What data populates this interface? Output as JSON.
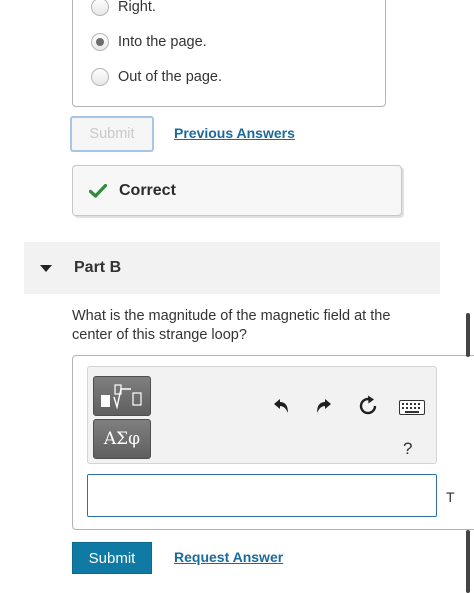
{
  "part_a": {
    "choices": [
      {
        "label": "Right.",
        "selected": false
      },
      {
        "label": "Into the page.",
        "selected": true
      },
      {
        "label": "Out of the page.",
        "selected": false
      }
    ],
    "submit_label": "Submit",
    "previous_answers_label": "Previous Answers",
    "feedback": "Correct"
  },
  "part_b": {
    "title": "Part B",
    "question": "What is the magnitude of the magnetic field at the center of this strange loop?",
    "toolbar": {
      "templates_icon": "templates-icon",
      "greek_label": "ΑΣφ",
      "undo_icon": "undo-icon",
      "redo_icon": "redo-icon",
      "reset_icon": "reset-icon",
      "keyboard_icon": "keyboard-icon",
      "help_label": "?"
    },
    "answer_value": "",
    "unit": "T",
    "submit_label": "Submit",
    "request_answer_label": "Request Answer"
  },
  "colors": {
    "primary_button": "#0f7aa3",
    "link": "#1b6a9c",
    "correct_check": "#2e8b3a",
    "input_border": "#2d6fa8"
  }
}
